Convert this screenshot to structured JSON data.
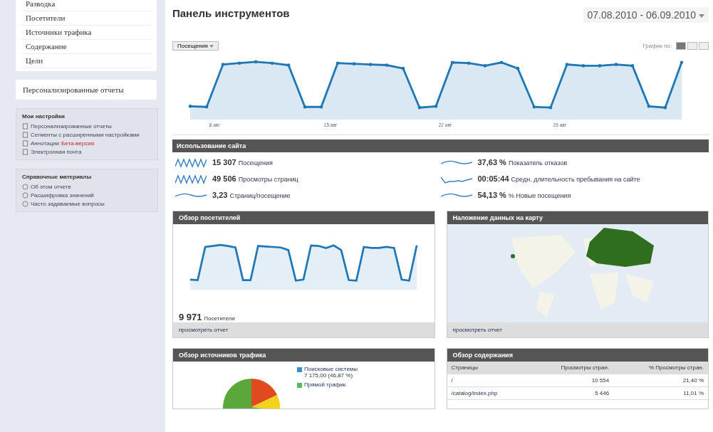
{
  "sidebar": {
    "nav": [
      {
        "label": "Разводка"
      },
      {
        "label": "Посетители"
      },
      {
        "label": "Источники трафика"
      },
      {
        "label": "Содержание"
      },
      {
        "label": "Цели"
      }
    ],
    "custom": {
      "label": "Персонализированные отчеты"
    },
    "settings": {
      "title": "Мои настройки",
      "items": [
        {
          "label": "Персонализированные отчеты"
        },
        {
          "label": "Сегменты с расширенными настройками"
        },
        {
          "label": "Аннотации",
          "badge": "Бета-версия"
        },
        {
          "label": "Электронная почта"
        }
      ]
    },
    "help": {
      "title": "Справочные материалы",
      "items": [
        {
          "label": "Об этом отчете"
        },
        {
          "label": "Расшифровка значений"
        },
        {
          "label": "Часто задаваемые вопросы"
        }
      ]
    }
  },
  "header": {
    "title": "Панель инструментов",
    "date_range": "07.08.2010 - 06.09.2010"
  },
  "main_chart": {
    "metric_button": "Посещения",
    "graph_by": "График по:",
    "views": [
      {
        "selected": true
      },
      {
        "selected": false
      },
      {
        "selected": false
      }
    ],
    "x_labels": [
      "8 авг",
      "15 авг",
      "22 авг",
      "29 авг"
    ]
  },
  "site_usage": {
    "title": "Использование сайта",
    "columns": [
      [
        {
          "value": "15 307",
          "label": "Посещения"
        },
        {
          "value": "49 506",
          "label": "Просмотры страниц"
        },
        {
          "value": "3,23",
          "label": "Страниц/посещение"
        }
      ],
      [
        {
          "value": "37,63 %",
          "label": "Показатель отказов"
        },
        {
          "value": "00:05:44",
          "label": "Средн. длительность пребывания на сайте"
        },
        {
          "value": "54,13 %",
          "label": "% Новые посещения"
        }
      ]
    ]
  },
  "visitors_overview": {
    "title": "Обзор посетителей",
    "total": "9 971",
    "total_label": "Посетители",
    "link": "просмотреть отчет"
  },
  "map_overlay": {
    "title": "Наложение данных на карту",
    "link": "просмотреть отчет"
  },
  "traffic_sources": {
    "title": "Обзор источников трафика",
    "legend": [
      {
        "label": "Поисковые системы",
        "value": "7 175,00 (46,87 %)",
        "color": "#3a8fc4"
      },
      {
        "label": "Прямой трафик",
        "color": "#5cb85c"
      }
    ]
  },
  "content_overview": {
    "title": "Обзор содержания",
    "columns": [
      "Страницы",
      "Просмотры стран.",
      "% Просмотры стран."
    ],
    "rows": [
      [
        "/",
        "10 554",
        "21,40 %"
      ],
      [
        "/catalog/index.php",
        "5 446",
        "11,01 %"
      ]
    ]
  }
}
